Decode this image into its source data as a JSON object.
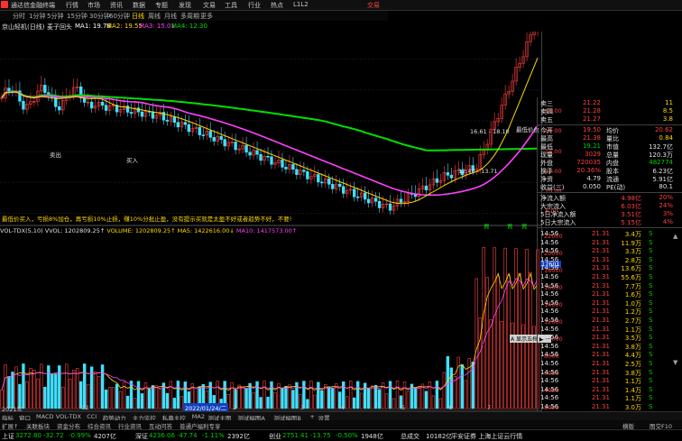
{
  "window": {
    "title": "通达信金融终端",
    "trade_label": "交易"
  },
  "menu": [
    "行情",
    "市场",
    "资讯",
    "数据",
    "专题",
    "发现",
    "文易",
    "工具",
    "行业",
    "热点",
    "L1L2"
  ],
  "periods": [
    "分时",
    "1分钟",
    "5分钟",
    "15分钟",
    "30分钟",
    "60分钟",
    "日线",
    "周线",
    "月线",
    "多周期",
    "更多"
  ],
  "selected_period": "日线",
  "info": {
    "stock": "京山轻机(日线)",
    "indicator": "麦子回头",
    "ma1": "MA1: 19.78",
    "ma2": "MA2: 19.55",
    "ma3": "MA3: 15.01",
    "ma4": "MA4: 12.30"
  },
  "chart_annotations": {
    "text_line": "最低价买入，亏损8%加仓，再亏损10%止损，赚10%分批止盈，没有提示买就是太盈不好或者趋势不好，不要!",
    "labels": [
      "卖出",
      "买入",
      "买出",
      "最低价位"
    ],
    "ranges": [
      "16.61 - 18.10",
      "12.46 - 13.71"
    ],
    "buy_markers": [
      "買",
      "買",
      "買"
    ]
  },
  "price_axis": {
    "ticks": [
      "18.00",
      "16.00",
      "14.00",
      "12.00",
      "10.00",
      "8.00"
    ],
    "current_tag": "16.15"
  },
  "volume_info": {
    "indicator": "VOL-TDX(5,10)",
    "vvol": "VVOL: 1202809.25↑",
    "volume": "VOLUME: 1202809.25↑",
    "ma5": "MA5: 1422616.00↓",
    "ma10": "MA10: 1417573.00↑"
  },
  "volume_axis": {
    "ticks": [
      "22000",
      "20000",
      "18000",
      "16000",
      "14000",
      "12000",
      "10000",
      "8000",
      "6000",
      "4000",
      "2000"
    ],
    "tag": "17601"
  },
  "date_axis": {
    "labels": [
      "2021年",
      "12",
      "2022/01/24/二",
      "2",
      "3",
      "4",
      "5",
      "6",
      "7"
    ]
  },
  "tooltip": "A 显示五档  ▶ 一",
  "quote_panel": {
    "orders": [
      {
        "label": "卖三",
        "price": "21.22",
        "vol": "11"
      },
      {
        "label": "卖四",
        "price": "21.28",
        "vol": "8.5"
      },
      {
        "label": "卖五",
        "price": "21.27",
        "vol": "3.8"
      }
    ],
    "stats": [
      {
        "l1": "今开",
        "v1": "19.50",
        "l2": "均价",
        "v2": "20.62"
      },
      {
        "l1": "最高",
        "v1": "21.38",
        "l2": "量比",
        "v2": "0.84"
      },
      {
        "l1": "最低",
        "v1": "19.21",
        "l2": "市值",
        "v2": "132.7亿"
      },
      {
        "l1": "现量",
        "v1": "3029",
        "l2": "总量",
        "v2": "120.3万"
      },
      {
        "l1": "外盘",
        "v1": "720035",
        "l2": "内盘",
        "v2": "482774"
      },
      {
        "l1": "换手",
        "v1": "20.36%",
        "l2": "股本",
        "v2": "6.23亿"
      },
      {
        "l1": "净资",
        "v1": "4.79",
        "l2": "流通",
        "v2": "5.91亿"
      },
      {
        "l1": "收益(三)",
        "v1": "0.050",
        "l2": "PE(动)",
        "v2": "80.1"
      }
    ],
    "flows": [
      {
        "label": "净流入额",
        "v": "4.98亿",
        "p": "20%"
      },
      {
        "label": "大宗流入",
        "v": "6.03亿",
        "p": "24%"
      },
      {
        "label": "5日净流入额",
        "v": "3.51亿",
        "p": "3%"
      },
      {
        "label": "5日大宗流入",
        "v": "5.15亿",
        "p": "4%"
      }
    ],
    "ticks": [
      {
        "t": "14:56",
        "p": "21.31",
        "v": "3.4万",
        "d": "S"
      },
      {
        "t": "14:56",
        "p": "21.31",
        "v": "11.9万",
        "d": "S"
      },
      {
        "t": "14:56",
        "p": "21.31",
        "v": "3.3万",
        "d": "S"
      },
      {
        "t": "14:56",
        "p": "21.31",
        "v": "2.8万",
        "d": "S"
      },
      {
        "t": "14:56",
        "p": "21.31",
        "v": "13.6万",
        "d": "S"
      },
      {
        "t": "14:56",
        "p": "21.31",
        "v": "55.6万",
        "d": "S"
      },
      {
        "t": "14:56",
        "p": "21.31",
        "v": "7.7万",
        "d": "S"
      },
      {
        "t": "14:56",
        "p": "21.31",
        "v": "1.6万",
        "d": "S"
      },
      {
        "t": "14:56",
        "p": "21.31",
        "v": "1.0万",
        "d": "S"
      },
      {
        "t": "14:56",
        "p": "21.31",
        "v": "1.2万",
        "d": "S"
      },
      {
        "t": "14:56",
        "p": "21.31",
        "v": "2.7万",
        "d": "S"
      },
      {
        "t": "14:56",
        "p": "21.31",
        "v": "1.1万",
        "d": "S"
      },
      {
        "t": "14:56",
        "p": "21.31",
        "v": "3.5万",
        "d": "S"
      },
      {
        "t": "14:56",
        "p": "21.31",
        "v": "3.8万",
        "d": "S"
      },
      {
        "t": "14:56",
        "p": "21.31",
        "v": "4.4万",
        "d": "S"
      },
      {
        "t": "14:56",
        "p": "21.31",
        "v": "2.5万",
        "d": "S"
      },
      {
        "t": "14:56",
        "p": "21.31",
        "v": "3.8万",
        "d": "S"
      },
      {
        "t": "14:56",
        "p": "21.31",
        "v": "1.1万",
        "d": "S"
      },
      {
        "t": "14:56",
        "p": "21.31",
        "v": "1.4万",
        "d": "S"
      },
      {
        "t": "14:56",
        "p": "21.31",
        "v": "1.1万",
        "d": "S"
      },
      {
        "t": "14:56",
        "p": "21.31",
        "v": "3.0万",
        "d": "S"
      }
    ],
    "tick_scroll": [
      "▲",
      "▼"
    ]
  },
  "tabs1": [
    "指标",
    "窗口",
    "MACD",
    "VOL-TDX",
    "CCI",
    "趋势动力",
    "主力监控",
    "私募主控",
    "MA2",
    "测试主图",
    "测试幅图A",
    "测试幅图B",
    "+",
    "设置"
  ],
  "tabs2": [
    "扩展↑",
    "关联板块",
    "资金分布",
    "综合资讯",
    "行业资讯",
    "互动问答",
    "普通户福利专享"
  ],
  "tabs2_right": [
    "横版",
    "图交F10"
  ],
  "status": [
    {
      "name": "上证",
      "val": "3272.80",
      "chg": "-32.72",
      "pct": "-0.99%",
      "amt": "4207亿"
    },
    {
      "name": "深证",
      "val": "4236.06",
      "chg": "-47.74",
      "pct": "-1.11%",
      "amt": "2392亿"
    },
    {
      "name": "创业",
      "val": "2751.41",
      "chg": "-13.75",
      "pct": "-0.50%",
      "amt": "1948亿"
    }
  ],
  "status_extra": {
    "label": "总成交",
    "amt": "10182亿",
    "note": "平安证券 上海上证云行情"
  },
  "watermark": "www.7gpzb.com",
  "chart_data": {
    "type": "candlestick+volume",
    "price_ylim": [
      8,
      19.5
    ],
    "volume_ylim": [
      0,
      23000
    ]
  },
  "colors": {
    "up": "#ff4040",
    "down": "#40e0ff",
    "ma1": "#ffffff",
    "ma2": "#ffd800",
    "ma3": "#ff40ff",
    "ma4": "#00e000",
    "bg": "#000000"
  }
}
